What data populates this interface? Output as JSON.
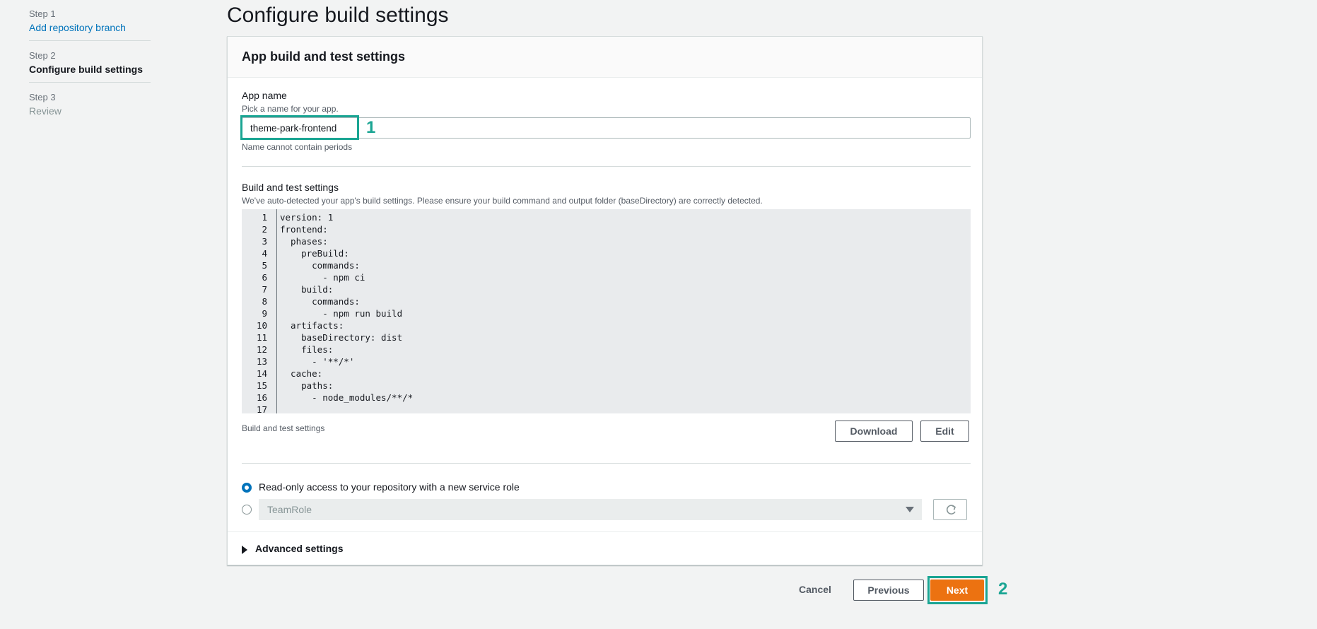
{
  "steps": [
    {
      "num": "Step 1",
      "label": "Add repository branch"
    },
    {
      "num": "Step 2",
      "label": "Configure build settings"
    },
    {
      "num": "Step 3",
      "label": "Review"
    }
  ],
  "page_title": "Configure build settings",
  "card": {
    "title": "App build and test settings",
    "app_name": {
      "label": "App name",
      "description": "Pick a name for your app.",
      "value": "theme-park-frontend",
      "constraint": "Name cannot contain periods"
    },
    "build_settings": {
      "label": "Build and test settings",
      "description": "We've auto-detected your app's build settings. Please ensure your build command and output folder (baseDirectory) are correctly detected.",
      "lines": [
        {
          "n": "1",
          "text": "version: 1"
        },
        {
          "n": "2",
          "text": "frontend:"
        },
        {
          "n": "3",
          "text": "  phases:"
        },
        {
          "n": "4",
          "text": "    preBuild:"
        },
        {
          "n": "5",
          "text": "      commands:"
        },
        {
          "n": "6",
          "text": "        - npm ci"
        },
        {
          "n": "7",
          "text": "    build:"
        },
        {
          "n": "8",
          "text": "      commands:"
        },
        {
          "n": "9",
          "text": "        - npm run build"
        },
        {
          "n": "10",
          "text": "  artifacts:"
        },
        {
          "n": "11",
          "text": "    baseDirectory: dist"
        },
        {
          "n": "12",
          "text": "    files:"
        },
        {
          "n": "13",
          "text": "      - '**/*'"
        },
        {
          "n": "14",
          "text": "  cache:"
        },
        {
          "n": "15",
          "text": "    paths:"
        },
        {
          "n": "16",
          "text": "      - node_modules/**/*"
        },
        {
          "n": "17",
          "text": ""
        }
      ],
      "footer_label": "Build and test settings",
      "download_label": "Download",
      "edit_label": "Edit"
    },
    "service_role": {
      "option_new": "Read-only access to your repository with a new service role",
      "option_existing_value": "TeamRole",
      "selected": "new"
    },
    "advanced_label": "Advanced settings"
  },
  "footer": {
    "cancel_label": "Cancel",
    "previous_label": "Previous",
    "next_label": "Next"
  },
  "annotations": {
    "marker_1": "1",
    "marker_2": "2"
  },
  "colors": {
    "accent": "#ec7211",
    "link": "#0073bb",
    "annotation": "#1aa593"
  }
}
